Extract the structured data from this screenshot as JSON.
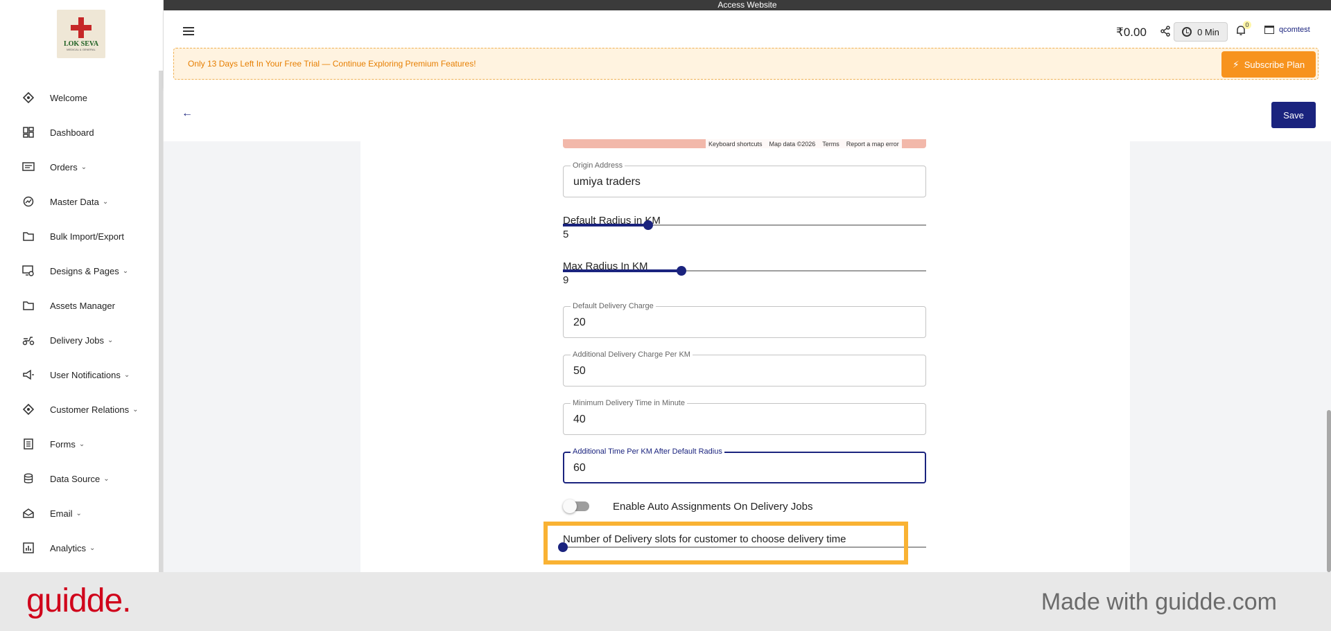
{
  "top_bar": {
    "title": "Access Website"
  },
  "brand": {
    "logo_text": "LOK SEVA",
    "logo_subtext": "MEDICAL & GENERAL"
  },
  "sidebar": {
    "items": [
      {
        "label": "Welcome",
        "icon": "badge-icon",
        "has_submenu": false
      },
      {
        "label": "Dashboard",
        "icon": "dashboard-icon",
        "has_submenu": false
      },
      {
        "label": "Orders",
        "icon": "orders-icon",
        "has_submenu": true
      },
      {
        "label": "Master Data",
        "icon": "master-data-icon",
        "has_submenu": true
      },
      {
        "label": "Bulk Import/Export",
        "icon": "folder-icon",
        "has_submenu": false
      },
      {
        "label": "Designs & Pages",
        "icon": "designs-icon",
        "has_submenu": true
      },
      {
        "label": "Assets Manager",
        "icon": "folder-icon",
        "has_submenu": false
      },
      {
        "label": "Delivery Jobs",
        "icon": "scooter-icon",
        "has_submenu": true
      },
      {
        "label": "User Notifications",
        "icon": "megaphone-icon",
        "has_submenu": true
      },
      {
        "label": "Customer Relations",
        "icon": "badge-icon",
        "has_submenu": true
      },
      {
        "label": "Forms",
        "icon": "forms-icon",
        "has_submenu": true
      },
      {
        "label": "Data Source",
        "icon": "database-icon",
        "has_submenu": true
      },
      {
        "label": "Email",
        "icon": "email-icon",
        "has_submenu": true
      },
      {
        "label": "Analytics",
        "icon": "analytics-icon",
        "has_submenu": true
      }
    ]
  },
  "header": {
    "balance": "₹0.00",
    "timer": "0 Min",
    "notifications_count": "0",
    "store_name": "qcomtest",
    "trial_text": "Only 13 Days Left In Your Free Trial — Continue Exploring Premium Features!",
    "subscribe_label": "Subscribe Plan"
  },
  "toolbar": {
    "save_label": "Save"
  },
  "map": {
    "attribution": [
      "Keyboard shortcuts",
      "Map data ©2026",
      "Terms",
      "Report a map error"
    ]
  },
  "form": {
    "origin_address": {
      "label": "Origin Address",
      "value": "umiya traders"
    },
    "default_radius": {
      "label": "Default Radius in KM",
      "value": "5",
      "fraction": 0.235
    },
    "max_radius": {
      "label": "Max Radius In KM",
      "value": "9",
      "fraction": 0.327
    },
    "default_delivery_charge": {
      "label": "Default Delivery Charge",
      "value": "20"
    },
    "additional_charge_per_km": {
      "label": "Additional Delivery Charge Per KM",
      "value": "50"
    },
    "min_delivery_time": {
      "label": "Minimum Delivery Time in Minute",
      "value": "40"
    },
    "additional_time_per_km": {
      "label": "Additional Time Per KM After Default Radius",
      "value": "60"
    },
    "auto_assign": {
      "label": "Enable Auto Assignments On Delivery Jobs",
      "enabled": false
    },
    "delivery_slots": {
      "label": "Number of Delivery slots for customer to choose delivery time",
      "fraction": 0
    }
  },
  "footer": {
    "brand": "guidde.",
    "made_with": "Made with guidde.com"
  },
  "colors": {
    "primary": "#1a237e",
    "accent": "#f7931e",
    "highlight": "#f9b233",
    "brand_red": "#d0021b"
  }
}
